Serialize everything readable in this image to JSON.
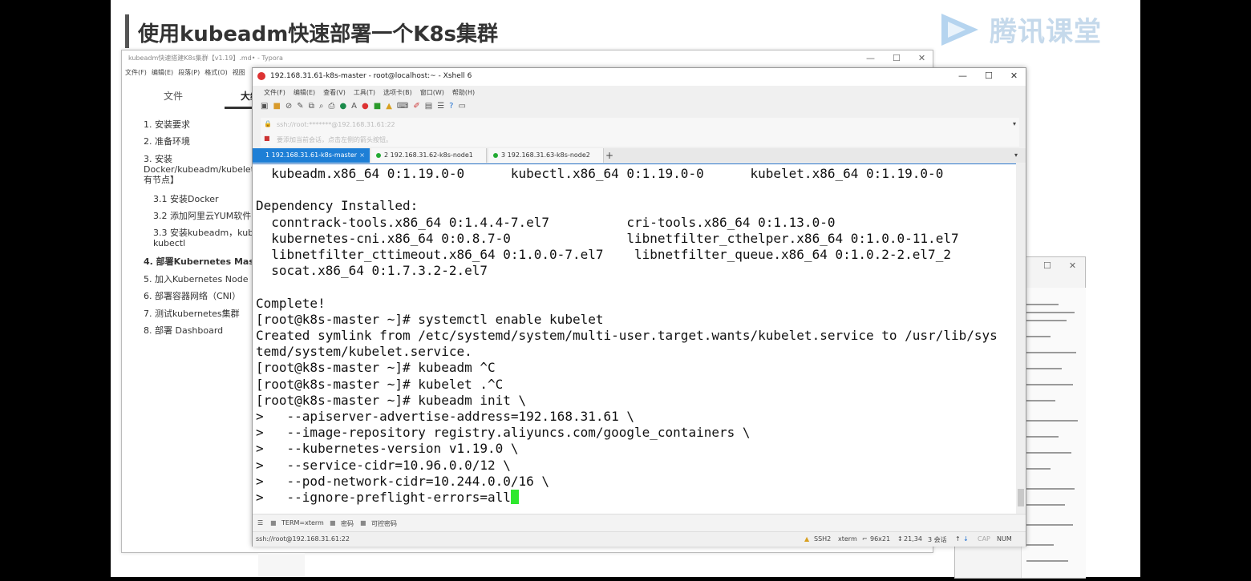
{
  "slide": {
    "title": "使用kubeadm快速部署一个K8s集群",
    "brand": "腾讯课堂"
  },
  "typora": {
    "title": "kubeadm快速搭建K8s集群【v1.19】.md• - Typora",
    "menu": [
      "文件(F)",
      "编辑(E)",
      "段落(P)",
      "格式(O)",
      "视图"
    ],
    "tabs": {
      "file": "文件",
      "outline": "大纲"
    },
    "outline": [
      "1. 安装要求",
      "2. 准备环境",
      "3. 安装",
      "Docker/kubeadm/kubelet",
      "有节点】",
      "3.1 安装Docker",
      "3.2 添加阿里云YUM软件",
      "3.3 安装kubeadm，kub",
      "kubectl",
      "4. 部署Kubernetes Mast",
      "5. 加入Kubernetes Node",
      "6. 部署容器网络（CNI）",
      "7. 测试kubernetes集群",
      "8. 部署 Dashboard"
    ]
  },
  "xshell": {
    "title": "192.168.31.61-k8s-master - root@localhost:~ - Xshell 6",
    "menu": [
      "文件(F)",
      "编辑(E)",
      "查看(V)",
      "工具(T)",
      "选项卡(B)",
      "窗口(W)",
      "帮助(H)"
    ],
    "address": "ssh://root:*******@192.168.31.61:22",
    "notice": "要添加当前会话，点击左侧的箭头按钮。",
    "tabs": [
      {
        "label": "1 192.168.31.61-k8s-master",
        "dot": "#ffffff"
      },
      {
        "label": "2 192.168.31.62-k8s-node1",
        "dot": "#22aa33"
      },
      {
        "label": "3 192.168.31.63-k8s-node2",
        "dot": "#22aa33"
      }
    ],
    "terminal": {
      "lines": [
        "  kubeadm.x86_64 0:1.19.0-0      kubectl.x86_64 0:1.19.0-0      kubelet.x86_64 0:1.19.0-0",
        "",
        "Dependency Installed:",
        "  conntrack-tools.x86_64 0:1.4.4-7.el7          cri-tools.x86_64 0:1.13.0-0",
        "  kubernetes-cni.x86_64 0:0.8.7-0               libnetfilter_cthelper.x86_64 0:1.0.0-11.el7",
        "  libnetfilter_cttimeout.x86_64 0:1.0.0-7.el7    libnetfilter_queue.x86_64 0:1.0.2-2.el7_2",
        "  socat.x86_64 0:1.7.3.2-2.el7",
        "",
        "Complete!",
        "[root@k8s-master ~]# systemctl enable kubelet",
        "Created symlink from /etc/systemd/system/multi-user.target.wants/kubelet.service to /usr/lib/sys",
        "temd/system/kubelet.service.",
        "[root@k8s-master ~]# kubeadm ^C",
        "[root@k8s-master ~]# kubelet .^C",
        "[root@k8s-master ~]# kubeadm init \\",
        ">   --apiserver-advertise-address=192.168.31.61 \\",
        ">   --image-repository registry.aliyuncs.com/google_containers \\",
        ">   --kubernetes-version v1.19.0 \\",
        ">   --service-cidr=10.96.0.0/12 \\",
        ">   --pod-network-cidr=10.244.0.0/16 \\"
      ],
      "last_line": ">   --ignore-preflight-errors=all"
    },
    "bottom_bar": {
      "term": "TERM=xterm",
      "pw": "密码",
      "ctrl": "可控密码"
    },
    "status": {
      "left": "ssh://root@192.168.31.61:22",
      "ssh": "SSH2",
      "term": "xterm",
      "size": "96x21",
      "pos": "21,34",
      "sessions": "3 会话",
      "cap": "CAP",
      "num": "NUM"
    }
  }
}
